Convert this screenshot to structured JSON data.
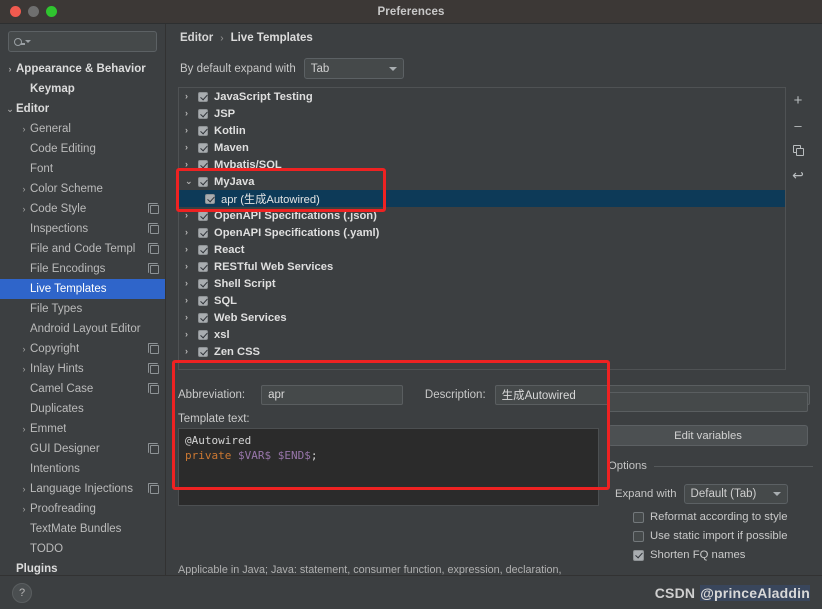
{
  "window": {
    "title": "Preferences"
  },
  "search": {
    "placeholder": ""
  },
  "sidebar": {
    "items": [
      {
        "label": "Appearance & Behavior",
        "arrow": "›",
        "level": 0,
        "bold": true,
        "copy": false,
        "selected": false
      },
      {
        "label": "Keymap",
        "arrow": "",
        "level": 1,
        "bold": true,
        "copy": false,
        "selected": false
      },
      {
        "label": "Editor",
        "arrow": "⌄",
        "level": 0,
        "bold": true,
        "copy": false,
        "selected": false
      },
      {
        "label": "General",
        "arrow": "›",
        "level": 1,
        "bold": false,
        "copy": false,
        "selected": false
      },
      {
        "label": "Code Editing",
        "arrow": "",
        "level": 1,
        "bold": false,
        "copy": false,
        "selected": false
      },
      {
        "label": "Font",
        "arrow": "",
        "level": 1,
        "bold": false,
        "copy": false,
        "selected": false
      },
      {
        "label": "Color Scheme",
        "arrow": "›",
        "level": 1,
        "bold": false,
        "copy": false,
        "selected": false
      },
      {
        "label": "Code Style",
        "arrow": "›",
        "level": 1,
        "bold": false,
        "copy": true,
        "selected": false
      },
      {
        "label": "Inspections",
        "arrow": "",
        "level": 1,
        "bold": false,
        "copy": true,
        "selected": false
      },
      {
        "label": "File and Code Templ",
        "arrow": "",
        "level": 1,
        "bold": false,
        "copy": true,
        "selected": false
      },
      {
        "label": "File Encodings",
        "arrow": "",
        "level": 1,
        "bold": false,
        "copy": true,
        "selected": false
      },
      {
        "label": "Live Templates",
        "arrow": "",
        "level": 1,
        "bold": false,
        "copy": false,
        "selected": true
      },
      {
        "label": "File Types",
        "arrow": "",
        "level": 1,
        "bold": false,
        "copy": false,
        "selected": false
      },
      {
        "label": "Android Layout Editor",
        "arrow": "",
        "level": 1,
        "bold": false,
        "copy": false,
        "selected": false
      },
      {
        "label": "Copyright",
        "arrow": "›",
        "level": 1,
        "bold": false,
        "copy": true,
        "selected": false
      },
      {
        "label": "Inlay Hints",
        "arrow": "›",
        "level": 1,
        "bold": false,
        "copy": true,
        "selected": false
      },
      {
        "label": "Camel Case",
        "arrow": "",
        "level": 1,
        "bold": false,
        "copy": true,
        "selected": false
      },
      {
        "label": "Duplicates",
        "arrow": "",
        "level": 1,
        "bold": false,
        "copy": false,
        "selected": false
      },
      {
        "label": "Emmet",
        "arrow": "›",
        "level": 1,
        "bold": false,
        "copy": false,
        "selected": false
      },
      {
        "label": "GUI Designer",
        "arrow": "",
        "level": 1,
        "bold": false,
        "copy": true,
        "selected": false
      },
      {
        "label": "Intentions",
        "arrow": "",
        "level": 1,
        "bold": false,
        "copy": false,
        "selected": false
      },
      {
        "label": "Language Injections",
        "arrow": "›",
        "level": 1,
        "bold": false,
        "copy": true,
        "selected": false
      },
      {
        "label": "Proofreading",
        "arrow": "›",
        "level": 1,
        "bold": false,
        "copy": false,
        "selected": false
      },
      {
        "label": "TextMate Bundles",
        "arrow": "",
        "level": 1,
        "bold": false,
        "copy": false,
        "selected": false
      },
      {
        "label": "TODO",
        "arrow": "",
        "level": 1,
        "bold": false,
        "copy": false,
        "selected": false
      },
      {
        "label": "Plugins",
        "arrow": "",
        "level": 0,
        "bold": true,
        "copy": false,
        "selected": false
      }
    ]
  },
  "breadcrumb": {
    "root": "Editor",
    "separator": "›",
    "current": "Live Templates"
  },
  "expand_default": {
    "label": "By default expand with",
    "value": "Tab"
  },
  "templates_tree": [
    {
      "label": "JavaScript Testing",
      "arrow": "›",
      "checked": true,
      "child": false,
      "selected": false
    },
    {
      "label": "JSP",
      "arrow": "›",
      "checked": true,
      "child": false,
      "selected": false
    },
    {
      "label": "Kotlin",
      "arrow": "›",
      "checked": true,
      "child": false,
      "selected": false
    },
    {
      "label": "Maven",
      "arrow": "›",
      "checked": true,
      "child": false,
      "selected": false
    },
    {
      "label": "Mybatis/SQL",
      "arrow": "›",
      "checked": true,
      "child": false,
      "selected": false
    },
    {
      "label": "MyJava",
      "arrow": "⌄",
      "checked": true,
      "child": false,
      "selected": false
    },
    {
      "label": "apr (生成Autowired)",
      "arrow": "",
      "checked": true,
      "child": true,
      "selected": true
    },
    {
      "label": "OpenAPI Specifications (.json)",
      "arrow": "›",
      "checked": true,
      "child": false,
      "selected": false
    },
    {
      "label": "OpenAPI Specifications (.yaml)",
      "arrow": "›",
      "checked": true,
      "child": false,
      "selected": false
    },
    {
      "label": "React",
      "arrow": "›",
      "checked": true,
      "child": false,
      "selected": false
    },
    {
      "label": "RESTful Web Services",
      "arrow": "›",
      "checked": true,
      "child": false,
      "selected": false
    },
    {
      "label": "Shell Script",
      "arrow": "›",
      "checked": true,
      "child": false,
      "selected": false
    },
    {
      "label": "SQL",
      "arrow": "›",
      "checked": true,
      "child": false,
      "selected": false
    },
    {
      "label": "Web Services",
      "arrow": "›",
      "checked": true,
      "child": false,
      "selected": false
    },
    {
      "label": "xsl",
      "arrow": "›",
      "checked": true,
      "child": false,
      "selected": false
    },
    {
      "label": "Zen CSS",
      "arrow": "›",
      "checked": true,
      "child": false,
      "selected": false
    }
  ],
  "toolbar": {
    "add": "add-template",
    "remove": "remove-template",
    "duplicate": "duplicate-template",
    "revert": "revert-template"
  },
  "detail": {
    "abbreviation_label": "Abbreviation:",
    "abbreviation_value": "apr",
    "description_label": "Description:",
    "description_value": "生成Autowired",
    "template_text_label": "Template text:",
    "template_line1": "@Autowired",
    "template_kw": "private",
    "template_var1": "$VAR$",
    "template_var2": "$END$",
    "template_semicolon": ";",
    "applicable": "Applicable in Java; Java: statement, consumer function, expression, declaration,"
  },
  "options": {
    "edit_variables_label": "Edit variables",
    "legend": "Options",
    "expand_with_label": "Expand with",
    "expand_with_value": "Default (Tab)",
    "checkboxes": [
      {
        "label": "Reformat according to style",
        "checked": false
      },
      {
        "label": "Use static import if possible",
        "checked": false
      },
      {
        "label": "Shorten FQ names",
        "checked": true
      }
    ]
  },
  "footer": {
    "help": "?",
    "watermark_prefix": "CSDN",
    "watermark_handle": "@princeAladdin"
  },
  "colors": {
    "window_bg": "#3c3f41",
    "titlebar_bg": "#3c3836",
    "sidebar_selection": "#2f65ca",
    "tree_selection": "#0d3a58",
    "annotation_red": "#ee2222",
    "editor_bg": "#2b2b2b",
    "keyword_orange": "#cc7832",
    "variable_purple": "#9876aa"
  }
}
